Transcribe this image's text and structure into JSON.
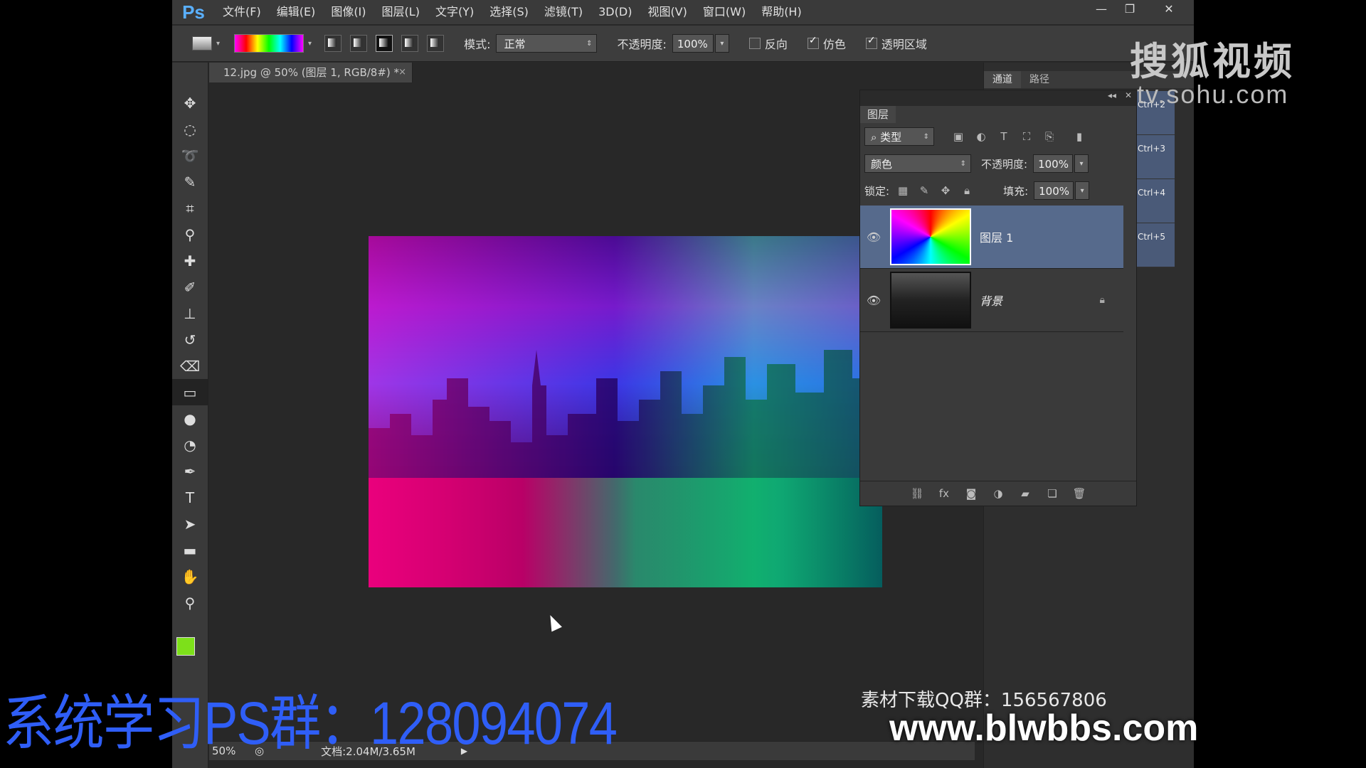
{
  "app": {
    "logo": "Ps"
  },
  "menu": [
    "文件(F)",
    "编辑(E)",
    "图像(I)",
    "图层(L)",
    "文字(Y)",
    "选择(S)",
    "滤镜(T)",
    "3D(D)",
    "视图(V)",
    "窗口(W)",
    "帮助(H)"
  ],
  "window_controls": {
    "minimize": "—",
    "restore": "❐",
    "close": "✕"
  },
  "options": {
    "mode_label": "模式:",
    "mode_value": "正常",
    "opacity_label": "不透明度:",
    "opacity_value": "100%",
    "reverse_label": "反向",
    "dither_label": "仿色",
    "transparency_label": "透明区域",
    "reverse_checked": false,
    "dither_checked": true,
    "transparency_checked": true
  },
  "document": {
    "tab_title": "12.jpg @ 50% (图层 1, RGB/8#) *",
    "tab_close": "×"
  },
  "status": {
    "zoom": "50%",
    "doc_size": "文档:2.04M/3.65M",
    "arrow": "▶"
  },
  "dock": {
    "tabs": [
      "通道",
      "路径"
    ],
    "shortcuts": [
      "Ctrl+2",
      "Ctrl+3",
      "Ctrl+4",
      "Ctrl+5"
    ]
  },
  "layers": {
    "title": "图层",
    "filter_kind": "类型",
    "blend_mode": "颜色",
    "opacity_label": "不透明度:",
    "opacity_value": "100%",
    "lock_label": "锁定:",
    "fill_label": "填充:",
    "fill_value": "100%",
    "items": [
      {
        "name": "图层 1",
        "selected": true
      },
      {
        "name": "背景",
        "selected": false,
        "locked": true
      }
    ]
  },
  "colors": {
    "foreground": "#7de01a",
    "background": "#ffffff",
    "accent": "#566a8c"
  },
  "overlays": {
    "watermark_logo": "搜狐视频",
    "watermark_url": "tv.sohu.com",
    "qq_group_text": "素材下载QQ群：156567806",
    "site": "www.blwbbs.com",
    "study_group": "系统学习PS群：128094074"
  }
}
